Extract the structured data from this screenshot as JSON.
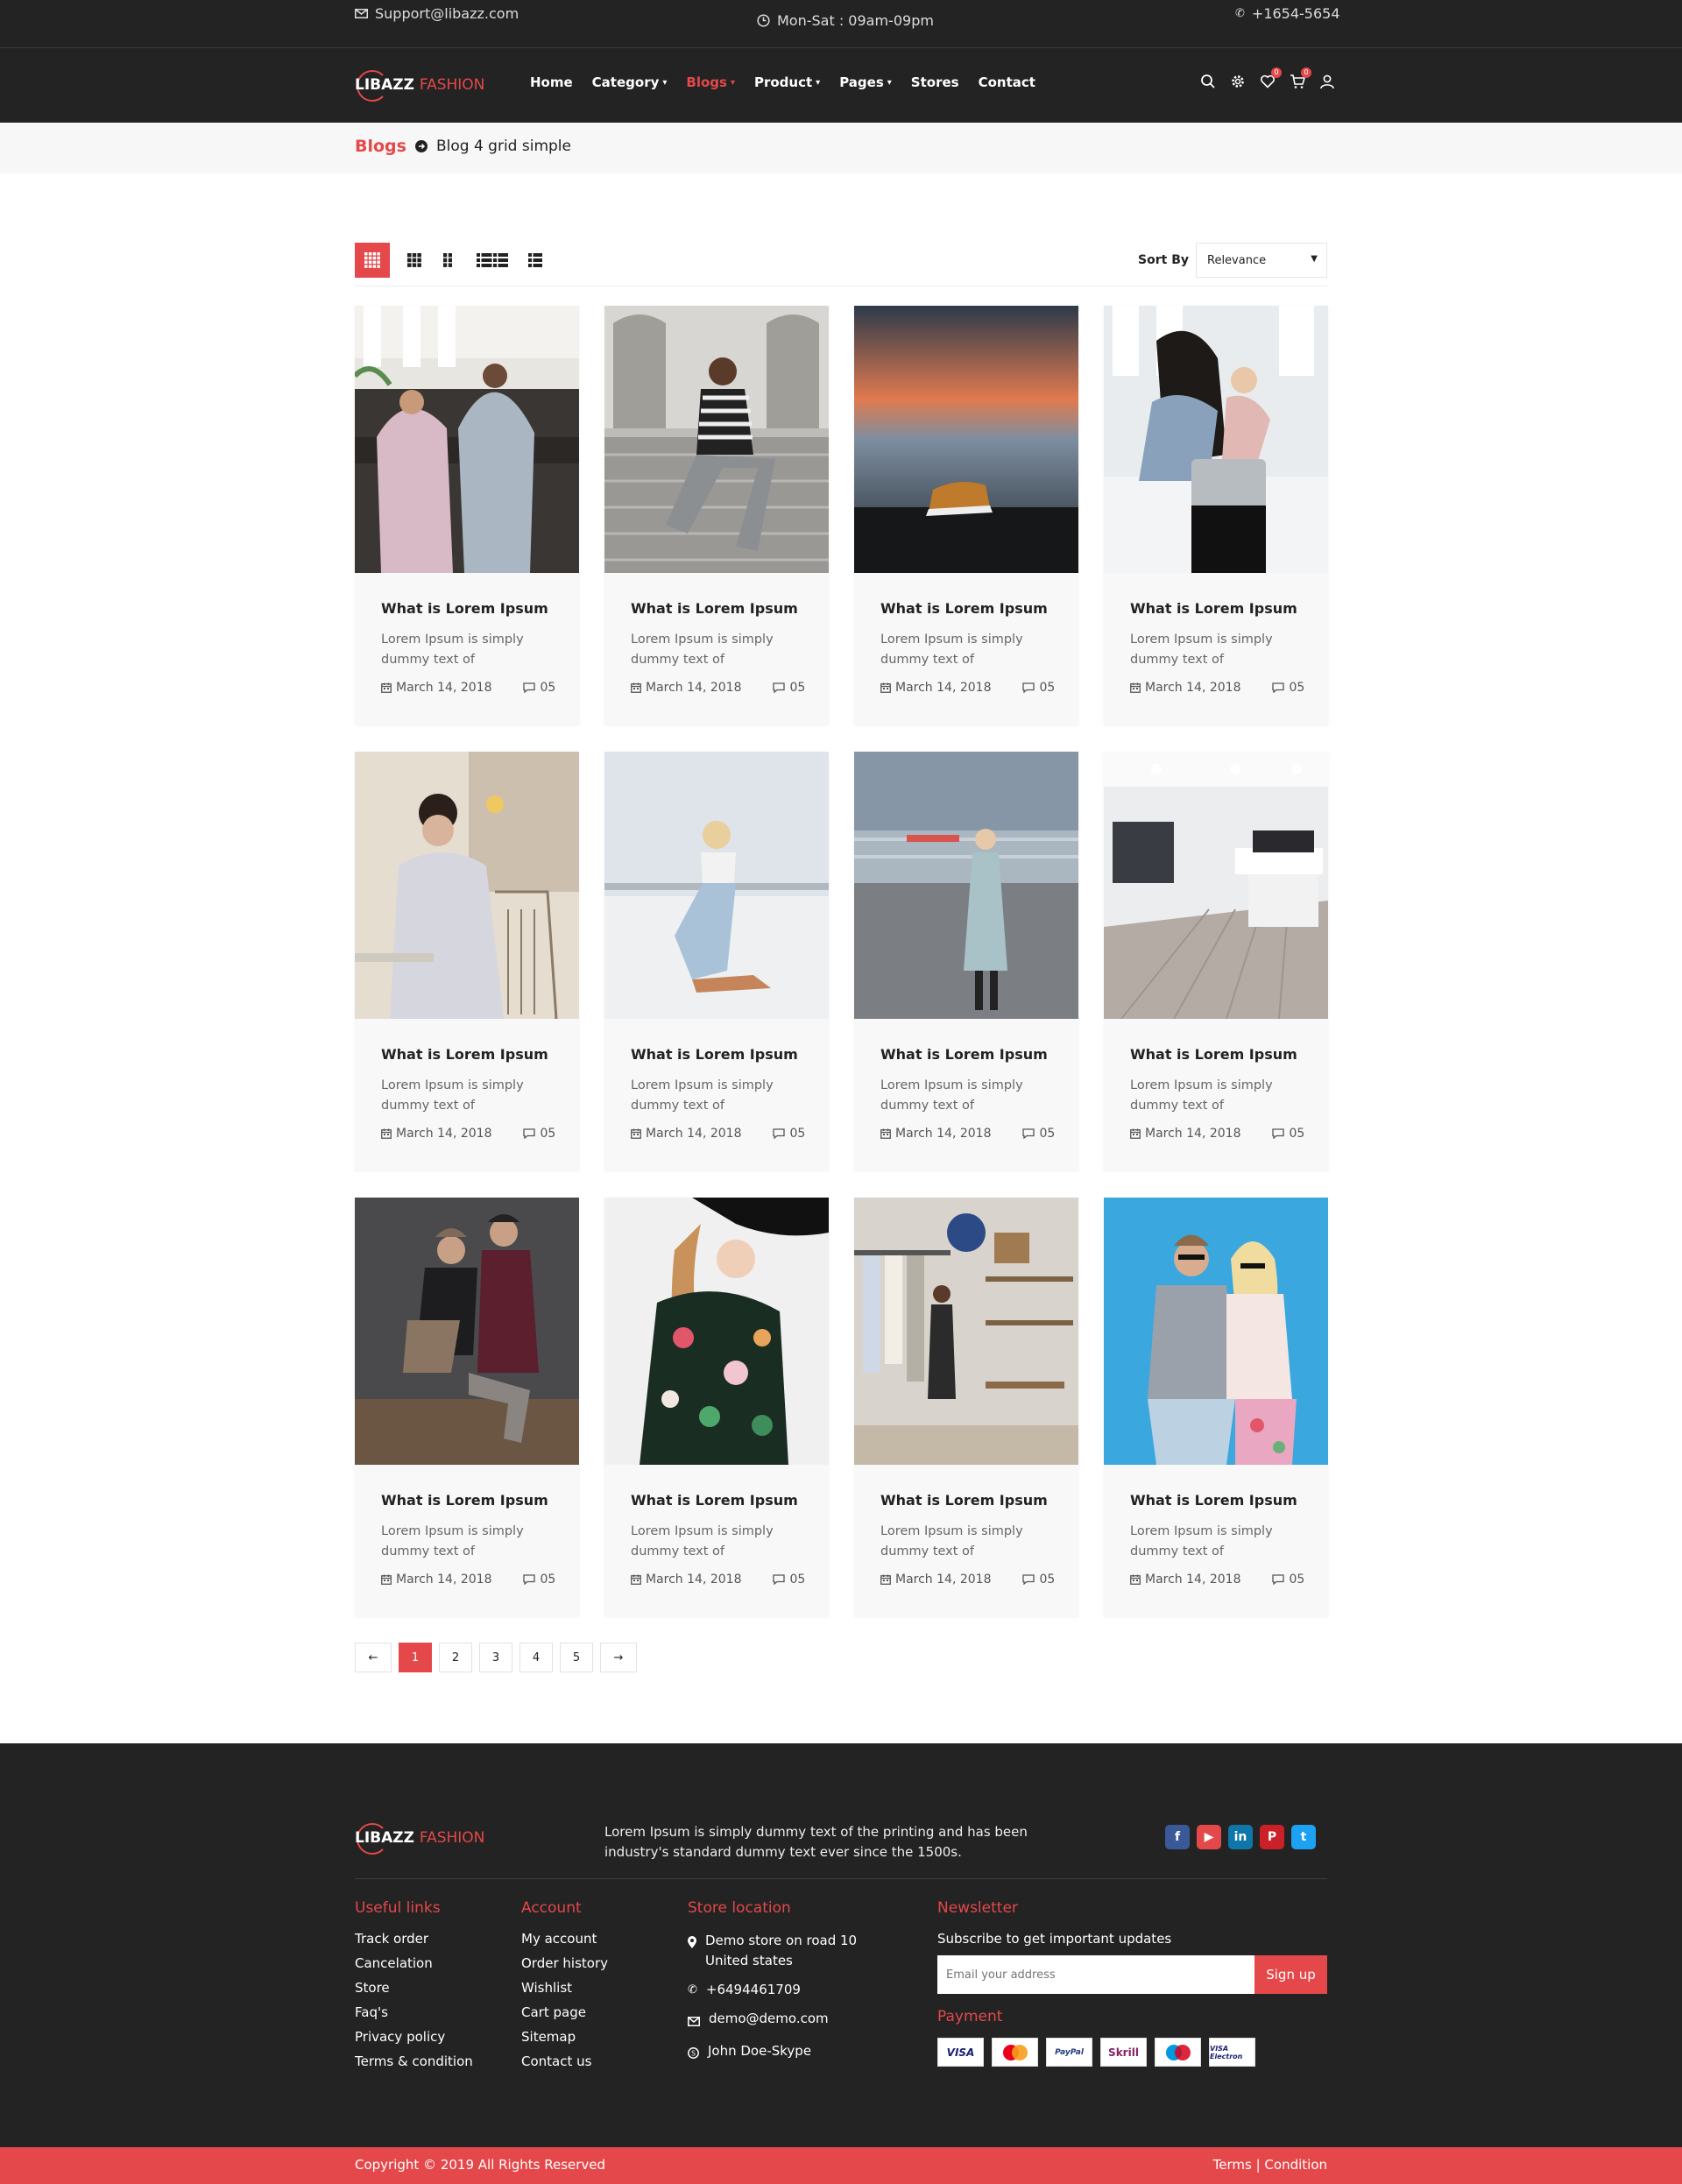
{
  "topbar": {
    "email": "Support@libazz.com",
    "hours": "Mon-Sat : 09am-09pm",
    "phone": "+1654-5654"
  },
  "header": {
    "logo_main": "LIBAZZ",
    "logo_accent": "FASHION",
    "nav": [
      {
        "label": "Home"
      },
      {
        "label": "Category",
        "dropdown": true
      },
      {
        "label": "Blogs",
        "dropdown": true,
        "active": true
      },
      {
        "label": "Product",
        "dropdown": true
      },
      {
        "label": "Pages",
        "dropdown": true
      },
      {
        "label": "Stores"
      },
      {
        "label": "Contact"
      }
    ],
    "icons": [
      "search-icon",
      "gear-icon",
      "heart-icon",
      "cart-icon",
      "user-icon"
    ],
    "wishlist_count": "0",
    "cart_count": "0"
  },
  "breadcrumb": {
    "parent": "Blogs",
    "current": "Blog 4 grid simple"
  },
  "toolbar": {
    "views": [
      "grid-4-icon",
      "grid-3-icon",
      "grid-2-icon",
      "list-2-icon",
      "list-icon"
    ],
    "sort_label": "Sort By",
    "sort_value": "Relevance"
  },
  "posts": [
    {
      "title": "What is Lorem Ipsum",
      "desc": "Lorem Ipsum is simply dummy text of",
      "date": "March 14, 2018",
      "comments": "05"
    },
    {
      "title": "What is Lorem Ipsum",
      "desc": "Lorem Ipsum is simply dummy text of",
      "date": "March 14, 2018",
      "comments": "05"
    },
    {
      "title": "What is Lorem Ipsum",
      "desc": "Lorem Ipsum is simply dummy text of",
      "date": "March 14, 2018",
      "comments": "05"
    },
    {
      "title": "What is Lorem Ipsum",
      "desc": "Lorem Ipsum is simply dummy text of",
      "date": "March 14, 2018",
      "comments": "05"
    },
    {
      "title": "What is Lorem Ipsum",
      "desc": "Lorem Ipsum is simply dummy text of",
      "date": "March 14, 2018",
      "comments": "05"
    },
    {
      "title": "What is Lorem Ipsum",
      "desc": "Lorem Ipsum is simply dummy text of",
      "date": "March 14, 2018",
      "comments": "05"
    },
    {
      "title": "What is Lorem Ipsum",
      "desc": "Lorem Ipsum is simply dummy text of",
      "date": "March 14, 2018",
      "comments": "05"
    },
    {
      "title": "What is Lorem Ipsum",
      "desc": "Lorem Ipsum is simply dummy text of",
      "date": "March 14, 2018",
      "comments": "05"
    },
    {
      "title": "What is Lorem Ipsum",
      "desc": "Lorem Ipsum is simply dummy text of",
      "date": "March 14, 2018",
      "comments": "05"
    },
    {
      "title": "What is Lorem Ipsum",
      "desc": "Lorem Ipsum is simply dummy text of",
      "date": "March 14, 2018",
      "comments": "05"
    },
    {
      "title": "What is Lorem Ipsum",
      "desc": "Lorem Ipsum is simply dummy text of",
      "date": "March 14, 2018",
      "comments": "05"
    },
    {
      "title": "What is Lorem Ipsum",
      "desc": "Lorem Ipsum is simply dummy text of",
      "date": "March 14, 2018",
      "comments": "05"
    }
  ],
  "pagination": {
    "prev": "←",
    "pages": [
      "1",
      "2",
      "3",
      "4",
      "5"
    ],
    "active": "1",
    "next": "→"
  },
  "footer": {
    "logo_main": "LIBAZZ",
    "logo_accent": "FASHION",
    "description": "Lorem Ipsum is simply dummy text of the printing and has been industry's standard dummy text ever since the 1500s.",
    "social": [
      {
        "icon": "facebook-icon",
        "glyph": "f",
        "color": "#3b5998"
      },
      {
        "icon": "youtube-icon",
        "glyph": "▶",
        "color": "#e4484a"
      },
      {
        "icon": "linkedin-icon",
        "glyph": "in",
        "color": "#0e76a8"
      },
      {
        "icon": "pinterest-icon",
        "glyph": "P",
        "color": "#cb2027"
      },
      {
        "icon": "twitter-icon",
        "glyph": "t",
        "color": "#1da1f2"
      }
    ],
    "useful_links": {
      "heading": "Useful links",
      "items": [
        "Track order",
        "Cancelation",
        "Store",
        "Faq's",
        "Privacy policy",
        "Terms & condition"
      ]
    },
    "account": {
      "heading": "Account",
      "items": [
        "My account",
        "Order history",
        "Wishlist",
        "Cart page",
        "Sitemap",
        "Contact us"
      ]
    },
    "store_location": {
      "heading": "Store location",
      "address_line1": "Demo store on road 10",
      "address_line2": "United states",
      "phone": "+6494461709",
      "email": "demo@demo.com",
      "skype": "John Doe-Skype"
    },
    "newsletter": {
      "heading": "Newsletter",
      "subtitle": "Subscribe to get important updates",
      "placeholder": "Email your address",
      "button": "Sign up",
      "payment_heading": "Payment",
      "payments": [
        "VISA",
        "Mastercard",
        "PayPal",
        "Skrill",
        "Maestro",
        "VISA Electron"
      ]
    }
  },
  "bottombar": {
    "copyright": "Copyright © 2019 All Rights Reserved",
    "terms": "Terms | Condition"
  },
  "colors": {
    "accent": "#e4484a",
    "dark": "#232323"
  }
}
